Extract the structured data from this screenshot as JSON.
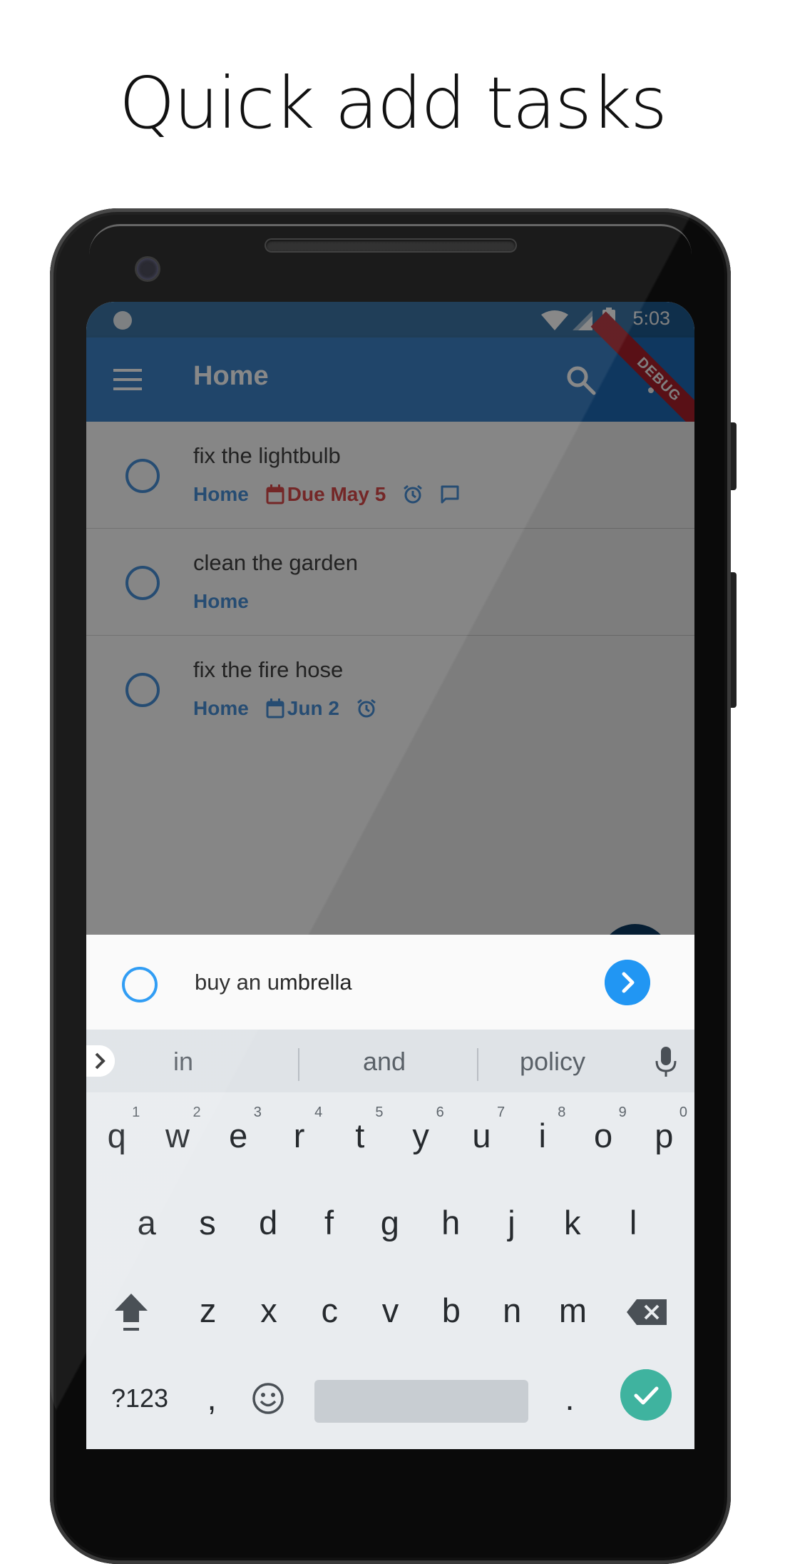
{
  "headline": "Quick add tasks",
  "status_bar": {
    "time": "5:03"
  },
  "debug_banner": "DEBUG",
  "app_bar": {
    "title": "Home"
  },
  "tasks": [
    {
      "title": "fix the lightbulb",
      "list": "Home",
      "due": "Due May 5",
      "due_state": "overdue",
      "icons": [
        "alarm-icon",
        "comment-icon"
      ]
    },
    {
      "title": "clean the garden",
      "list": "Home",
      "due": "",
      "due_state": "none",
      "icons": []
    },
    {
      "title": "fix the fire hose",
      "list": "Home",
      "due": "Jun 2",
      "due_state": "normal",
      "icons": [
        "alarm-icon"
      ]
    }
  ],
  "quick_add": {
    "value": "buy an umbrella"
  },
  "keyboard": {
    "suggestions": [
      "in",
      "and",
      "policy"
    ],
    "row1": [
      {
        "k": "q",
        "n": "1"
      },
      {
        "k": "w",
        "n": "2"
      },
      {
        "k": "e",
        "n": "3"
      },
      {
        "k": "r",
        "n": "4"
      },
      {
        "k": "t",
        "n": "5"
      },
      {
        "k": "y",
        "n": "6"
      },
      {
        "k": "u",
        "n": "7"
      },
      {
        "k": "i",
        "n": "8"
      },
      {
        "k": "o",
        "n": "9"
      },
      {
        "k": "p",
        "n": "0"
      }
    ],
    "row2": [
      "a",
      "s",
      "d",
      "f",
      "g",
      "h",
      "j",
      "k",
      "l"
    ],
    "row3": [
      "z",
      "x",
      "c",
      "v",
      "b",
      "n",
      "m"
    ],
    "row4": {
      "symbols": "?123",
      "comma": ",",
      "period": "."
    }
  },
  "colors": {
    "accent": "#2196f3",
    "task_blue": "#2d7fd1",
    "overdue_red": "#d32f2f",
    "appbar": "#1e6fbf",
    "statusbar": "#1e5f96",
    "enter_key": "#3fb39f",
    "debug_ribbon": "#b3202d"
  }
}
